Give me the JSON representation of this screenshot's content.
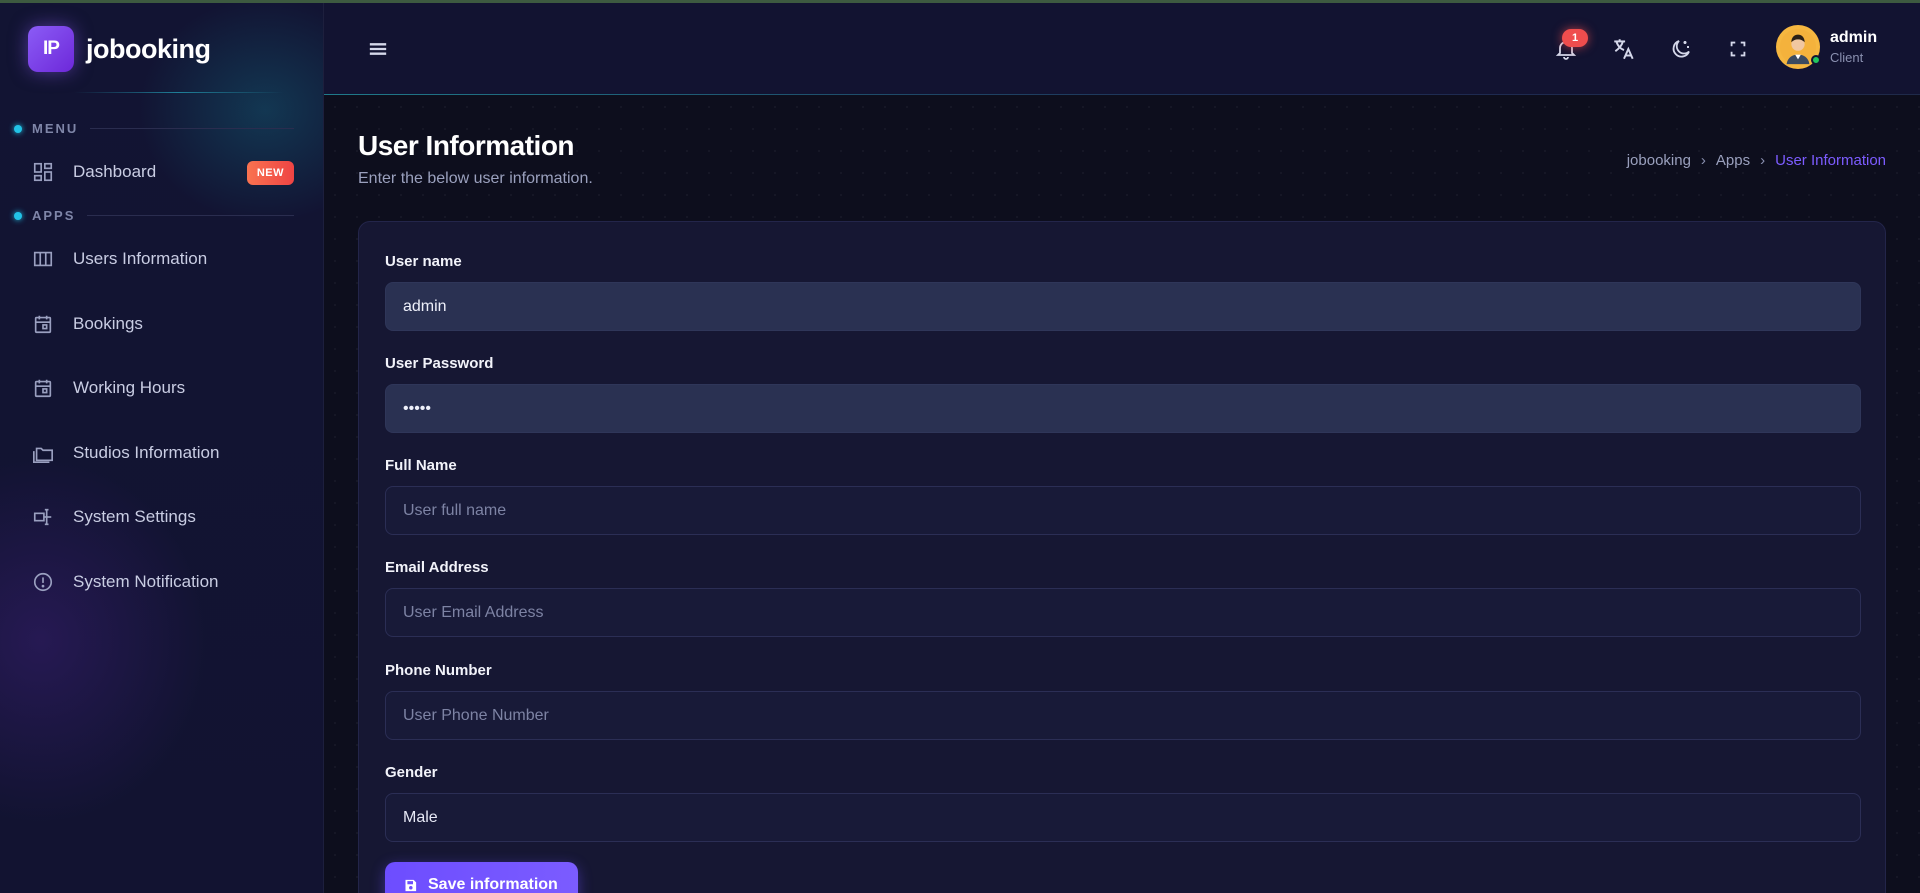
{
  "brand": {
    "logo_text": "IP",
    "name": "jobooking"
  },
  "sidebar": {
    "sections": [
      {
        "label": "MENU"
      },
      {
        "label": "APPS"
      }
    ],
    "items": [
      {
        "label": "Dashboard",
        "badge": "NEW",
        "icon": "dashboard-icon"
      },
      {
        "label": "Users Information",
        "icon": "table-columns-icon"
      },
      {
        "label": "Bookings",
        "icon": "calendar-icon"
      },
      {
        "label": "Working Hours",
        "icon": "calendar-icon"
      },
      {
        "label": "Studios Information",
        "icon": "folders-icon"
      },
      {
        "label": "System Settings",
        "icon": "settings-sliders-icon"
      },
      {
        "label": "System Notification",
        "icon": "alert-circle-icon"
      }
    ]
  },
  "header": {
    "notification_count": "1",
    "user": {
      "name": "admin",
      "role": "Client"
    }
  },
  "page": {
    "title": "User Information",
    "subtitle": "Enter the below user information.",
    "breadcrumb": [
      "jobooking",
      "Apps",
      "User Information"
    ]
  },
  "form": {
    "username": {
      "label": "User name",
      "value": "admin"
    },
    "password": {
      "label": "User Password",
      "value": "•••••"
    },
    "full_name": {
      "label": "Full Name",
      "value": "",
      "placeholder": "User full name"
    },
    "email": {
      "label": "Email Address",
      "value": "",
      "placeholder": "User Email Address"
    },
    "phone": {
      "label": "Phone Number",
      "value": "",
      "placeholder": "User Phone Number"
    },
    "gender": {
      "label": "Gender",
      "value": "Male"
    },
    "save_label": "Save information"
  },
  "colors": {
    "accent": "#7b5cff",
    "badge": "#ef4d4d",
    "status_online": "#22c55e",
    "section_dot": "#22c3e6"
  }
}
